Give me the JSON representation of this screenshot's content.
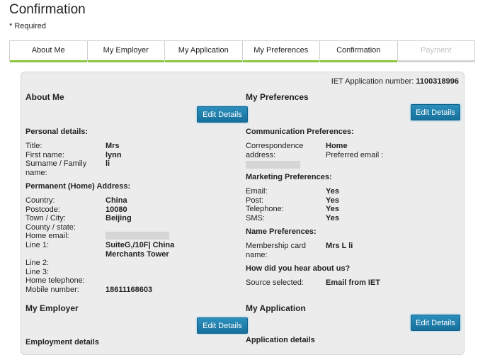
{
  "page": {
    "title": "Confirmation",
    "required_note": "* Required"
  },
  "tabs": [
    {
      "label": "About Me"
    },
    {
      "label": "My Employer"
    },
    {
      "label": "My Application"
    },
    {
      "label": "My Preferences"
    },
    {
      "label": "Confirmation"
    },
    {
      "label": "Payment"
    }
  ],
  "application": {
    "number_label": "IET Application number:",
    "number": "1100318996"
  },
  "about_me": {
    "title": "About Me",
    "edit_label": "Edit Details",
    "personal_title": "Personal details:",
    "title_label": "Title:",
    "title_value": "Mrs",
    "first_name_label": "First name:",
    "first_name_value": "lynn",
    "surname_label": "Surname / Family name:",
    "surname_value": "li",
    "address_title": "Permanent (Home) Address:",
    "country_label": "Country:",
    "country_value": "China",
    "postcode_label": "Postcode:",
    "postcode_value": "10080",
    "town_label": "Town / City:",
    "town_value": "Beijing",
    "county_label": "County / state:",
    "email_label": "Home email:",
    "line1_label": "Line 1:",
    "line1_value": "SuiteG,/10F| China Merchants Tower",
    "line2_label": "Line 2:",
    "line3_label": "Line 3:",
    "home_phone_label": "Home telephone:",
    "mobile_label": "Mobile number:",
    "mobile_value": "18611168603"
  },
  "my_employer": {
    "title": "My Employer",
    "edit_label": "Edit Details",
    "employment_title": "Employment details"
  },
  "preferences": {
    "title": "My Preferences",
    "edit_label": "Edit Details",
    "comm_title": "Communication Preferences:",
    "corr_label": "Correspondence address:",
    "corr_value": "Home",
    "pref_email_label": "Preferred email :",
    "marketing_title": "Marketing Preferences:",
    "email_label": "Email:",
    "email_value": "Yes",
    "post_label": "Post:",
    "post_value": "Yes",
    "telephone_label": "Telephone:",
    "telephone_value": "Yes",
    "sms_label": "SMS:",
    "sms_value": "Yes",
    "name_title": "Name Preferences:",
    "card_label": "Membership card name:",
    "card_value": "Mrs L li",
    "hear_title": "How did you hear about us?",
    "source_label": "Source selected:",
    "source_value": "Email from IET"
  },
  "my_application": {
    "title": "My Application",
    "edit_label": "Edit Details",
    "details_title": "Application details"
  },
  "colors": {
    "accent_green": "#8cc63f",
    "button_blue": "#1f7fad",
    "panel_bg": "#ececec"
  }
}
